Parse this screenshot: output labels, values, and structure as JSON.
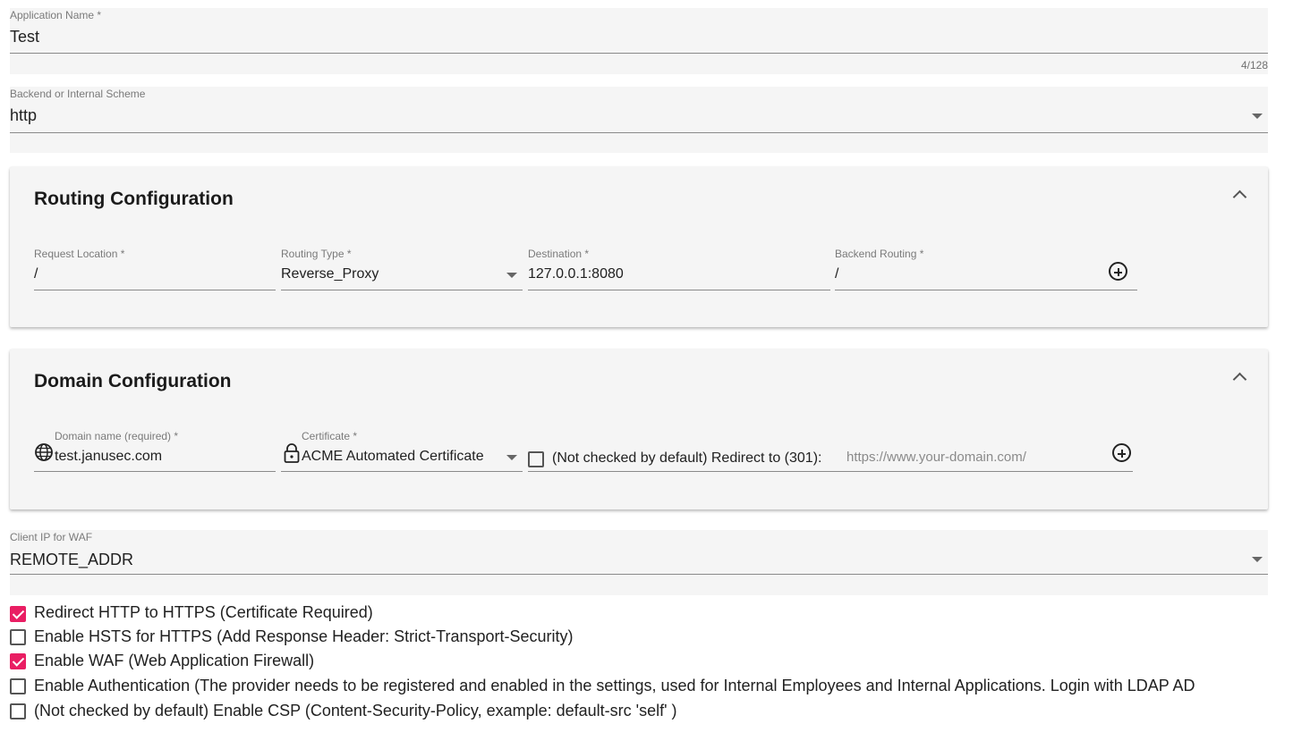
{
  "app_name": {
    "label": "Application Name *",
    "value": "Test",
    "counter": "4/128"
  },
  "backend_scheme": {
    "label": "Backend or Internal Scheme",
    "value": "http"
  },
  "routing": {
    "title": "Routing Configuration",
    "request_location": {
      "label": "Request Location *",
      "value": "/"
    },
    "routing_type": {
      "label": "Routing Type *",
      "value": "Reverse_Proxy"
    },
    "destination": {
      "label": "Destination *",
      "value": "127.0.0.1:8080"
    },
    "backend_routing": {
      "label": "Backend Routing *",
      "value": "/"
    }
  },
  "domain": {
    "title": "Domain Configuration",
    "domain_name": {
      "label": "Domain name (required) *",
      "value": "test.janusec.com"
    },
    "certificate": {
      "label": "Certificate *",
      "value": "ACME Automated Certificate"
    },
    "redirect_label": "(Not checked by default) Redirect to (301):",
    "redirect_placeholder": "https://www.your-domain.com/"
  },
  "client_ip": {
    "label": "Client IP for WAF",
    "value": "REMOTE_ADDR"
  },
  "options": [
    {
      "label": "Redirect HTTP to HTTPS (Certificate Required)",
      "checked": true
    },
    {
      "label": "Enable HSTS for HTTPS (Add Response Header: Strict-Transport-Security)",
      "checked": false
    },
    {
      "label": "Enable WAF (Web Application Firewall)",
      "checked": true
    },
    {
      "label": "Enable Authentication (The provider needs to be registered and enabled in the settings, used for Internal Employees and Internal Applications. Login with LDAP AD",
      "checked": false
    },
    {
      "label": "(Not checked by default) Enable CSP (Content-Security-Policy, example: default-src 'self' )",
      "checked": false
    }
  ],
  "colors": {
    "accent": "#e91e63",
    "field_bg": "#f5f5f5"
  }
}
